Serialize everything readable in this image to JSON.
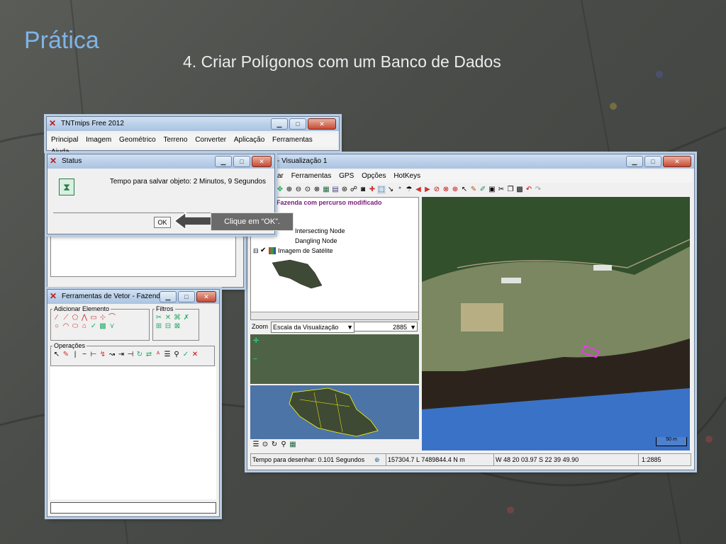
{
  "slide": {
    "title": "Prática",
    "subtitle": "4. Criar Polígonos com um Banco de Dados"
  },
  "tntmips": {
    "title": "TNTmips Free 2012",
    "menu": [
      "Principal",
      "Imagem",
      "Geométrico",
      "Terreno",
      "Converter",
      "Aplicação",
      "Ferramentas",
      "Ajuda"
    ]
  },
  "status": {
    "title": "Status",
    "message": "Tempo para salvar objeto: 2 Minutos, 9 Segundos",
    "ok_label": "OK"
  },
  "callout": {
    "text": "Clique em “OK”."
  },
  "vector_tools": {
    "title": "Ferramentas de Vetor - Fazenda ...",
    "add_group": "Adicionar Elemento",
    "filters_group": "Filtros",
    "ops_group": "Operações"
  },
  "viz": {
    "title": "- Visualização 1",
    "menu": [
      "ar",
      "Ferramentas",
      "GPS",
      "Opções",
      "HotKeys"
    ],
    "layer_title": "Fazenda com percurso modificado",
    "legend": [
      "Intersecting Node",
      "Dangling Node"
    ],
    "layer2": "Imagem de Satélite",
    "zoom_label": "Zoom",
    "zoom_select": "Escala da Visualização",
    "zoom_value": "2885",
    "scale_bar": "50 m",
    "status_draw": "Tempo para desenhar: 0.101 Segundos",
    "status_coords": "157304.7 L 7489844.4 N m",
    "status_latlon": "W 48 20 03.97  S 22 39 49.90",
    "status_scale": "1:2885"
  },
  "colors": {
    "title_blue": "#7fb4e8",
    "callout_bg": "#6b6b6b",
    "layer_title": "#7a1a7a"
  }
}
